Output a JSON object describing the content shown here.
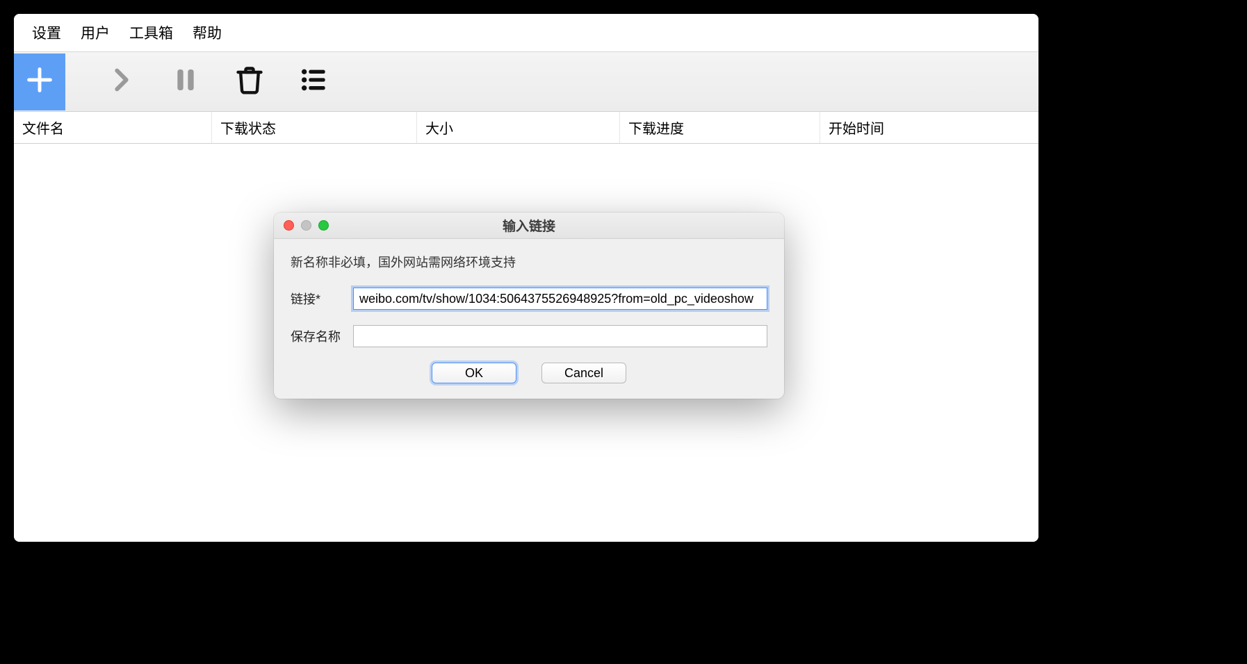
{
  "menubar": {
    "items": [
      "设置",
      "用户",
      "工具箱",
      "帮助"
    ]
  },
  "table": {
    "columns": {
      "filename": "文件名",
      "status": "下载状态",
      "size": "大小",
      "progress": "下载进度",
      "start_time": "开始时间"
    }
  },
  "dialog": {
    "title": "输入链接",
    "hint": "新名称非必填，国外网站需网络环境支持",
    "link_label": "链接*",
    "link_value": "weibo.com/tv/show/1034:5064375526948925?from=old_pc_videoshow",
    "name_label": "保存名称",
    "name_value": "",
    "ok": "OK",
    "cancel": "Cancel"
  }
}
